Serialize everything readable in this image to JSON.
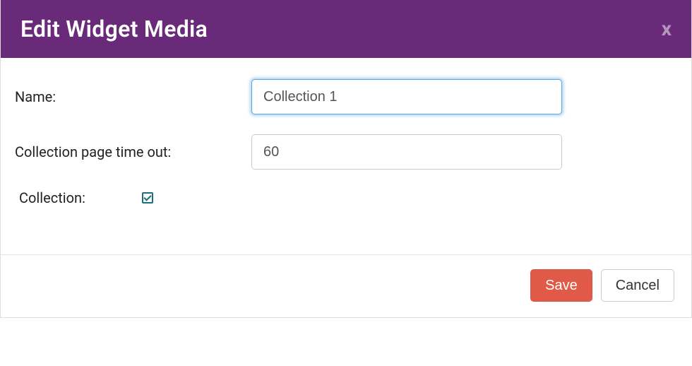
{
  "header": {
    "title": "Edit Widget Media",
    "close_label": "x"
  },
  "form": {
    "name": {
      "label": "Name:",
      "value": "Collection 1"
    },
    "timeout": {
      "label": "Collection page time out:",
      "value": "60"
    },
    "collection": {
      "label": "Collection:",
      "checked": true
    }
  },
  "footer": {
    "save_label": "Save",
    "cancel_label": "Cancel"
  }
}
